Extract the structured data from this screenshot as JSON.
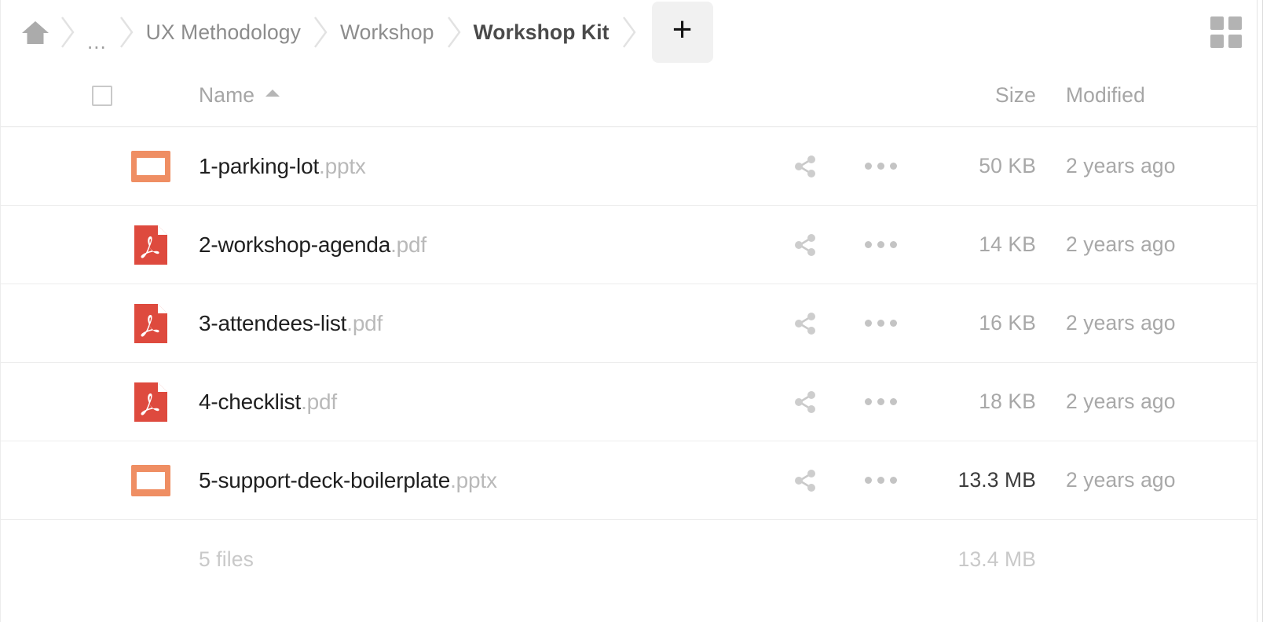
{
  "breadcrumb": {
    "home_icon": "home-icon",
    "items": [
      {
        "label": "...",
        "type": "ellipsis",
        "active": false
      },
      {
        "label": "UX Methodology",
        "type": "folder",
        "active": false
      },
      {
        "label": "Workshop",
        "type": "folder",
        "active": false
      },
      {
        "label": "Workshop Kit",
        "type": "folder",
        "active": true
      }
    ],
    "add_label": "+",
    "view_toggle_icon": "grid-view-icon"
  },
  "table": {
    "headers": {
      "name": "Name",
      "size": "Size",
      "modified": "Modified"
    },
    "sort": {
      "column": "Name",
      "direction": "asc",
      "icon": "caret-up-icon"
    },
    "select_all_checked": false,
    "rows": [
      {
        "name": "1-parking-lot",
        "ext": ".pptx",
        "icon": "pptx-file-icon",
        "size": "50 KB",
        "size_emphasis": false,
        "modified": "2 years ago"
      },
      {
        "name": "2-workshop-agenda",
        "ext": ".pdf",
        "icon": "pdf-file-icon",
        "size": "14 KB",
        "size_emphasis": false,
        "modified": "2 years ago"
      },
      {
        "name": "3-attendees-list",
        "ext": ".pdf",
        "icon": "pdf-file-icon",
        "size": "16 KB",
        "size_emphasis": false,
        "modified": "2 years ago"
      },
      {
        "name": "4-checklist",
        "ext": ".pdf",
        "icon": "pdf-file-icon",
        "size": "18 KB",
        "size_emphasis": false,
        "modified": "2 years ago"
      },
      {
        "name": "5-support-deck-boilerplate",
        "ext": ".pptx",
        "icon": "pptx-file-icon",
        "size": "13.3 MB",
        "size_emphasis": true,
        "modified": "2 years ago"
      }
    ],
    "row_actions": {
      "share_icon": "share-icon",
      "menu_icon": "more-actions-icon"
    },
    "footer": {
      "count": "5 files",
      "total_size": "13.4 MB"
    }
  },
  "colors": {
    "pptx_orange": "#ef8e63",
    "pdf_red": "#de4a3e",
    "text_primary": "#1f1f1f",
    "text_muted": "#a8a8a8",
    "extension_gray": "#b9b9b9",
    "row_border": "#ededed",
    "add_button_bg": "#f1f1f1"
  }
}
